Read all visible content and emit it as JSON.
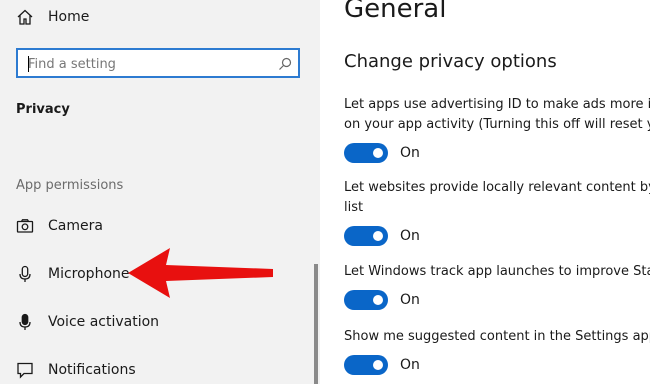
{
  "sidebar": {
    "home_label": "Home",
    "search_placeholder": "Find a setting",
    "section_title": "Privacy",
    "group_header": "App permissions",
    "items": [
      {
        "label": "Camera",
        "icon": "camera-icon"
      },
      {
        "label": "Microphone",
        "icon": "microphone-icon"
      },
      {
        "label": "Voice activation",
        "icon": "voice-activation-icon"
      },
      {
        "label": "Notifications",
        "icon": "notifications-icon"
      }
    ]
  },
  "annotation": {
    "arrow_color": "#e8100f",
    "points_to": "Microphone"
  },
  "main": {
    "title": "General",
    "subtitle": "Change privacy options",
    "options": [
      {
        "lines": [
          "Let apps use advertising ID to make ads more inte",
          "on your app activity (Turning this off will reset you"
        ],
        "toggle": "On"
      },
      {
        "lines": [
          "Let websites provide locally relevant content by ac",
          "list"
        ],
        "toggle": "On"
      },
      {
        "lines": [
          "Let Windows track app launches to improve Start"
        ],
        "toggle": "On"
      },
      {
        "lines": [
          "Show me suggested content in the Settings app"
        ],
        "toggle": "On"
      }
    ]
  },
  "colors": {
    "accent": "#0a66c8",
    "search_border": "#2d7bd1",
    "sidebar_bg": "#f2f2f2"
  }
}
